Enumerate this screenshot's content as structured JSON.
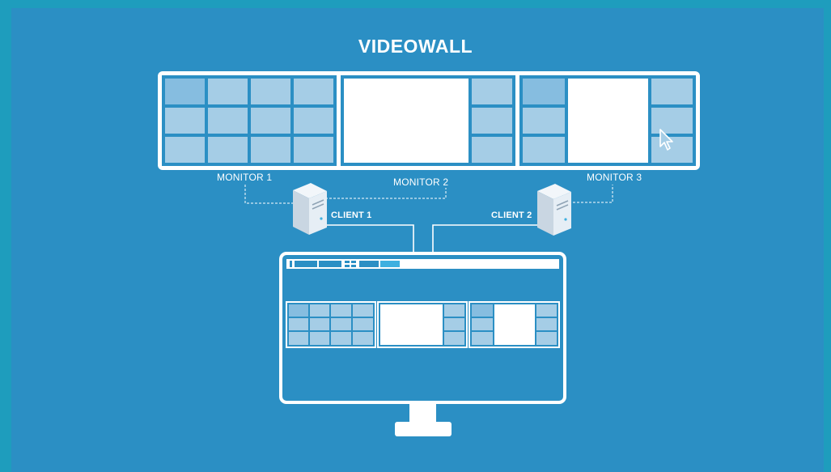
{
  "title": "VIDEOWALL",
  "monitors": [
    {
      "label": "MONITOR 1"
    },
    {
      "label": "MONITOR 2"
    },
    {
      "label": "MONITOR 3"
    }
  ],
  "clients": [
    {
      "label": "CLIENT 1"
    },
    {
      "label": "CLIENT 2"
    }
  ],
  "colors": {
    "background": "#2b8fc4",
    "outer_band": "#1e9dbd",
    "frame": "#ffffff",
    "tile": "#a5cde6",
    "tile_alt": "#86bde0",
    "highlight": "#3fb0e0"
  },
  "icons": [
    "server-icon",
    "cursor-icon",
    "desktop-monitor-icon"
  ]
}
